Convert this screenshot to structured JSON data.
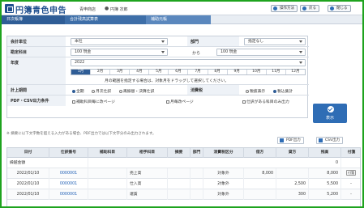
{
  "header": {
    "app_title": "円簿青色申告",
    "company": "青申商店",
    "user": "円簿 次郎",
    "buttons": [
      {
        "label": "操作方法",
        "icon": "help-icon",
        "color": "#2f6db5"
      },
      {
        "label": "戻る",
        "icon": "back-icon",
        "color": "#2f6db5"
      },
      {
        "label": "閉じる",
        "icon": "close-icon",
        "color": "#2f6db5"
      }
    ]
  },
  "breadcrumbs": [
    "日次帳簿",
    "合計残高試算表",
    "補助元帳"
  ],
  "filters": {
    "dept_label": "会計単位",
    "dept_value": "本社",
    "section_label": "部門",
    "section_value": "指定なし",
    "account_label": "勘定科目",
    "account_from": "100 現金",
    "from_to": "から",
    "account_to": "100 現金",
    "year_label": "年度",
    "year_value": "2022",
    "months": [
      "1月",
      "2月",
      "3月",
      "4月",
      "5月",
      "6月",
      "7月",
      "8月",
      "9月",
      "10月",
      "11月",
      "12月"
    ],
    "active_month": "1月",
    "hint": "月の範囲を指定する場合は、対象月をドラッグして選択してください。",
    "period_label": "計上期間",
    "period_options": [
      "全期",
      "月次仕訳",
      "再振替・決算仕訳"
    ],
    "period_selected": "全期",
    "tax_label": "消費税",
    "tax_options": [
      "税抜表示",
      "税込集計"
    ],
    "tax_selected": "税込集計",
    "output_label": "PDF・CSV出力条件",
    "output_options": [
      "補助科目毎に改ページ",
      "月毎改ページ",
      "仕訳がある科目のみ出力"
    ],
    "show_button": "表示"
  },
  "notes": {
    "summary": "※ 摘要に以下文字数を超える入力がある場合、PDF出力では以下文字分のみ出力されます。",
    "pdf_button": "PDF出力",
    "csv_button": "CSV出力"
  },
  "table": {
    "headers": [
      "日付",
      "仕訳番号",
      "補助科目",
      "相手科目",
      "摘要",
      "部門",
      "消費税区分",
      "借方",
      "貸方",
      "残高",
      "付箋"
    ],
    "rows": [
      {
        "date": "繰越金額",
        "no": "",
        "sub": "",
        "partner": "",
        "memo": "",
        "dept": "",
        "tax": "",
        "debit": "",
        "credit": "",
        "balance": "0",
        "tag": ""
      },
      {
        "date": "2022/01/10",
        "no": "0000001",
        "sub": "",
        "partner": "売上高",
        "memo": "",
        "dept": "",
        "tax": "対象外",
        "debit": "8,000",
        "credit": "",
        "balance": "8,000",
        "tag": "付箋"
      },
      {
        "date": "2022/01/10",
        "no": "0000001",
        "sub": "",
        "partner": "仕入高",
        "memo": "",
        "dept": "",
        "tax": "対象外",
        "debit": "",
        "credit": "2,500",
        "balance": "5,500",
        "tag": "-"
      },
      {
        "date": "2022/01/10",
        "no": "0000001",
        "sub": "",
        "partner": "運賃",
        "memo": "",
        "dept": "",
        "tax": "対象外",
        "debit": "",
        "credit": "300",
        "balance": "5,200",
        "tag": "-"
      }
    ]
  }
}
